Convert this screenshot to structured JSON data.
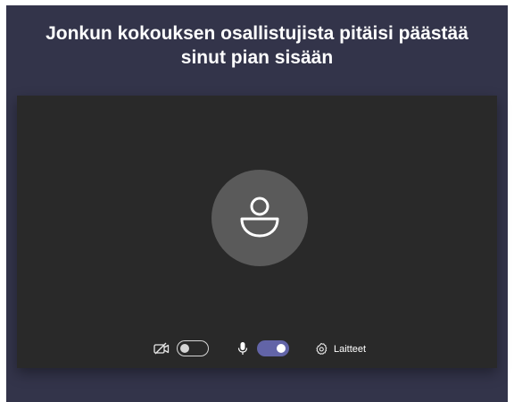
{
  "header": {
    "title_line1": "Jonkun kokouksen osallistujista pitäisi päästää",
    "title_line2": "sinut pian sisään"
  },
  "preview": {
    "avatar_icon": "person-icon",
    "camera": {
      "icon": "camera-off-icon",
      "enabled": false
    },
    "microphone": {
      "icon": "microphone-icon",
      "enabled": true
    },
    "devices": {
      "icon": "gear-icon",
      "label": "Laitteet"
    }
  },
  "colors": {
    "background": "#33344a",
    "preview_background": "#292929",
    "avatar_background": "#5a5a5a",
    "toggle_on": "#6264a7"
  }
}
